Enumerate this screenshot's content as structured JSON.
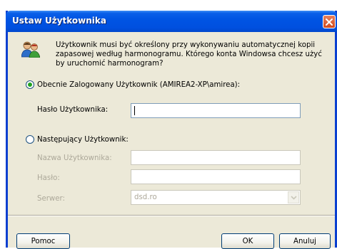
{
  "window": {
    "title": "Ustaw Użytkownika",
    "close_icon": "close-icon"
  },
  "info": {
    "icon": "users-icon",
    "text": "Użytkownik musi być określony przy wykonywaniu automatycznej kopii zapasowej według harmonogramu. Którego konta Windowsa chcesz użyć by uruchomić harmonogram?"
  },
  "current_user": {
    "radio_label": "Obecnie Zalogowany Użytkownik (AMIREA2-XP\\amirea):",
    "selected": true,
    "password_label": "Hasło Użytkownika:",
    "password_value": ""
  },
  "specific_user": {
    "radio_label": "Następujący Użytkownik:",
    "selected": false,
    "username_label": "Nazwa Użytkownika:",
    "username_value": "",
    "password_label": "Hasło:",
    "password_value": "",
    "server_label": "Serwer:",
    "server_value": "dsd.ro"
  },
  "buttons": {
    "help": "Pomoc",
    "ok": "OK",
    "cancel": "Anuluj"
  },
  "colors": {
    "titlebar": "#0054e3",
    "dialog_bg": "#ece9d8",
    "close_button": "#d34a1e",
    "radio_dot": "#21a121",
    "disabled_text": "#aca899"
  }
}
